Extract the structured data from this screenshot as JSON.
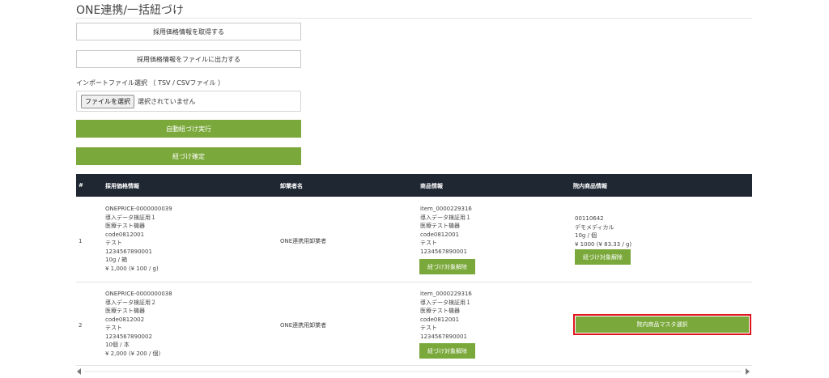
{
  "page": {
    "title": "ONE連携/一括紐づけ"
  },
  "actions": {
    "fetch_price": "採用価格情報を取得する",
    "export_price": "採用価格情報をファイルに出力する",
    "import_label": "インポートファイル選択 （ TSV / CSVファイル ）",
    "file_button": "ファイルを選択",
    "file_status": "選択されていません",
    "auto_link": "自動紐づけ実行",
    "confirm_link": "紐づけ確定"
  },
  "table": {
    "headers": [
      "#",
      "採用価格情報",
      "卸業者名",
      "商品情報",
      "院内商品情報"
    ],
    "rows": [
      {
        "index": "1",
        "price_info": [
          "ONEPRICE-0000000039",
          "導入データ検証用１",
          "医療テスト機器",
          "code0812001",
          "テスト",
          "1234567890001",
          "10g / 箱",
          "¥ 1,000 (¥ 100 / g)"
        ],
        "wholesaler": "ONE連携用卸業者",
        "product_info": [
          "item_0000229316",
          "導入データ検証用１",
          "医療テスト機器",
          "code0812001",
          "テスト",
          "1234567890001"
        ],
        "product_button": "紐づけ対象解除",
        "hospital_info": [
          "00110642",
          "デモメディカル",
          "10g / 個",
          "¥ 1000 (¥ 83.33 / g)"
        ],
        "hospital_button": "紐づけ対象解除"
      },
      {
        "index": "2",
        "price_info": [
          "ONEPRICE-0000000038",
          "導入データ検証用２",
          "医療テスト機器",
          "code0812002",
          "テスト",
          "1234567890002",
          "10個 / 本",
          "¥ 2,000 (¥ 200 / 個)"
        ],
        "wholesaler": "ONE連携用卸業者",
        "product_info": [
          "item_0000229316",
          "導入データ検証用１",
          "医療テスト機器",
          "code0812001",
          "テスト",
          "1234567890001"
        ],
        "product_button": "紐づけ対象解除",
        "hospital_button": "院内商品マスタ選択"
      }
    ]
  }
}
